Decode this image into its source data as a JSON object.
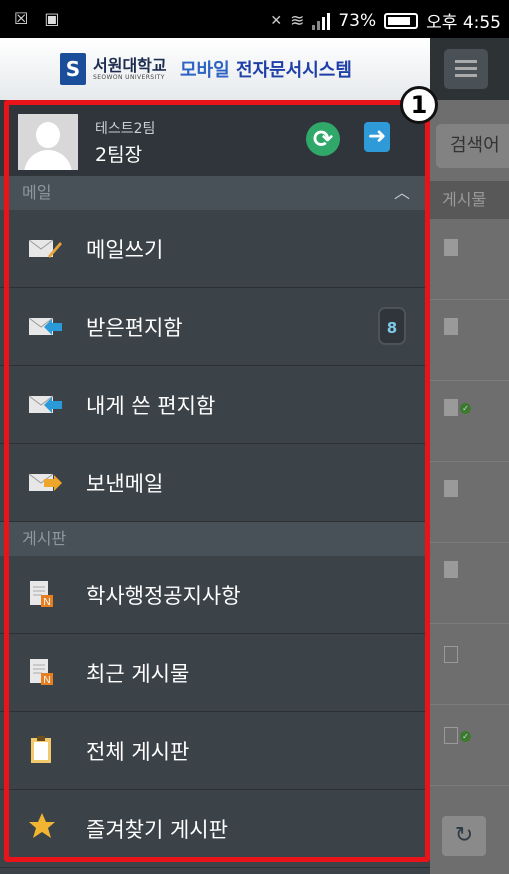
{
  "status_bar": {
    "battery": "73%",
    "time": "오후 4:55"
  },
  "header": {
    "logo_mark": "S",
    "logo_korean": "서원대학교",
    "logo_english": "SEOWON UNIVERSITY",
    "title_part1": "모바일",
    "title_part2": "전자문서시스템"
  },
  "profile": {
    "team": "테스트2팀",
    "name": "2팀장"
  },
  "sections": {
    "mail": {
      "label": "메일"
    },
    "board": {
      "label": "게시판"
    }
  },
  "menu": {
    "mail_items": [
      {
        "label": "메일쓰기",
        "icon": "compose-mail-icon"
      },
      {
        "label": "받은편지함",
        "icon": "inbox-icon",
        "badge": "8"
      },
      {
        "label": "내게 쓴 편지함",
        "icon": "self-mail-icon"
      },
      {
        "label": "보낸메일",
        "icon": "sent-mail-icon"
      }
    ],
    "board_items": [
      {
        "label": "학사행정공지사항",
        "icon": "notice-doc-icon"
      },
      {
        "label": "최근 게시물",
        "icon": "recent-doc-icon"
      },
      {
        "label": "전체 게시판",
        "icon": "clipboard-icon"
      },
      {
        "label": "즐겨찾기 게시판",
        "icon": "star-icon"
      }
    ]
  },
  "background_page": {
    "search_placeholder": "검색어",
    "column_header": "게시물"
  },
  "annotation": {
    "number": "1"
  },
  "colors": {
    "drawer_bg": "#3b4248",
    "section_bg": "#485157",
    "annotation": "#e8141a",
    "badge_text": "#7fc9e8"
  }
}
